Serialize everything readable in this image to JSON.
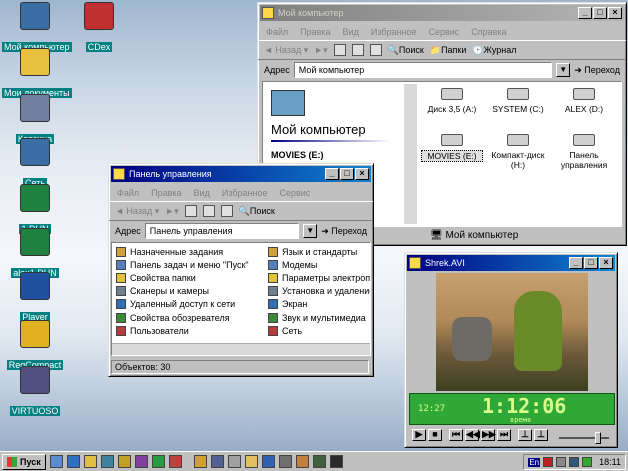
{
  "desktop": {
    "icons": [
      {
        "label": "Мой компьютер",
        "icon": "my-computer-icon",
        "color": "#3a6ea5"
      },
      {
        "label": "CDex",
        "icon": "cdex-icon",
        "color": "#c03030"
      },
      {
        "label": "Мои документы",
        "icon": "my-documents-icon",
        "color": "#e8c040"
      },
      {
        "label": "Корзина",
        "icon": "recycle-bin-icon",
        "color": "#7080a0"
      },
      {
        "label": "Сеть",
        "icon": "network-icon",
        "color": "#3a6ea5"
      },
      {
        "label": "1.DUN",
        "icon": "dialup-icon",
        "color": "#208040"
      },
      {
        "label": "alex1.DUN",
        "icon": "dialup-icon",
        "color": "#208040"
      },
      {
        "label": "Player",
        "icon": "player-icon",
        "color": "#2050a0"
      },
      {
        "label": "RegCompact",
        "icon": "regcompact-icon",
        "color": "#e0b020"
      },
      {
        "label": "VIRTUOSO",
        "icon": "virtuoso-icon",
        "color": "#505080"
      }
    ]
  },
  "mycomputer": {
    "title": "Мой компьютер",
    "menu": [
      "Файл",
      "Правка",
      "Вид",
      "Избранное",
      "Сервис",
      "Справка"
    ],
    "toolbar": {
      "back": "Назад",
      "search": "Поиск",
      "folders": "Папки",
      "journal": "Журнал"
    },
    "address_label": "Адрес",
    "address_value": "Мой компьютер",
    "go": "Переход",
    "header": "Мой компьютер",
    "selected_drive": "MOVIES (E:)",
    "drives": [
      "Диск 3,5 (A:)",
      "SYSTEM (C:)",
      "ALEX (D:)",
      "MOVIES (E:)",
      "Компакт-диск (H:)",
      "Панель управления"
    ],
    "status": "Мой компьютер"
  },
  "controlpanel": {
    "title": "Панель управления",
    "menu": [
      "Файл",
      "Правка",
      "Вид",
      "Избранное",
      "Сервис"
    ],
    "toolbar": {
      "back": "Назад",
      "search": "Поиск"
    },
    "address_label": "Адрес",
    "address_value": "Панель управления",
    "go": "Переход",
    "left_items": [
      "Назначенные задания",
      "Панель задач и меню \"Пуск\"",
      "Свойства папки",
      "Сканеры и камеры",
      "Удаленный доступ к сети",
      "Свойства обозревателя",
      "Пользователи"
    ],
    "right_items": [
      "Язык и стандарты",
      "Модемы",
      "Параметры электропи",
      "Установка и удаление",
      "Экран",
      "Звук и мультимедиа",
      "Сеть"
    ],
    "status": "Объектов: 30"
  },
  "player": {
    "title": "Shrek.AVI",
    "elapsed": "12:27",
    "time": "1:12:06",
    "time_label": "время"
  },
  "taskbar": {
    "start": "Пуск",
    "lang": "En",
    "clock": "18:11"
  }
}
